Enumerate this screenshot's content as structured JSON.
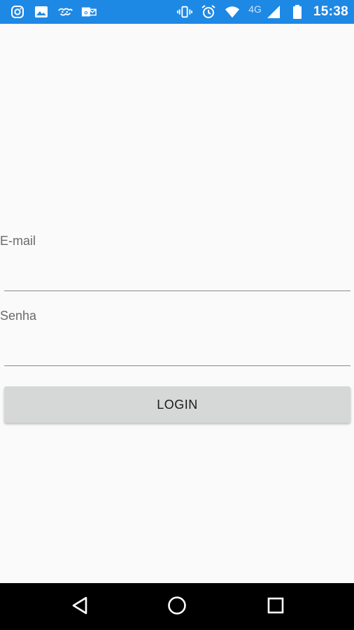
{
  "status_bar": {
    "left_icons": [
      "instagram-icon",
      "gallery-icon",
      "app-icon",
      "outlook-icon"
    ],
    "right_icons": [
      "vibrate-icon",
      "alarm-icon",
      "wifi-icon",
      "signal-icon",
      "battery-icon"
    ],
    "network": "4G",
    "time": "15:38",
    "color": "#1e88e5"
  },
  "form": {
    "email_label": "E-mail",
    "email_value": "",
    "password_label": "Senha",
    "password_value": "",
    "login_button": "LOGIN"
  },
  "nav_bar": {
    "icons": [
      "back-icon",
      "home-icon",
      "recents-icon"
    ]
  }
}
